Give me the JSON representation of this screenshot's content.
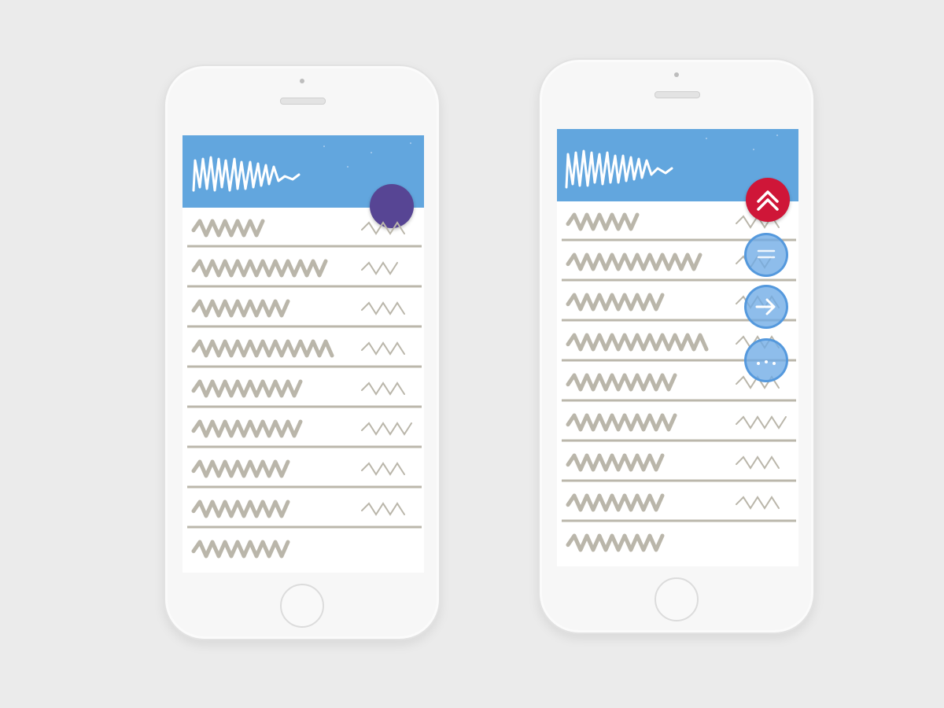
{
  "colors": {
    "background": "#ebebeb",
    "app_bar": "#62a6de",
    "primary_fab": "#574594",
    "speed_dial_top": "#cf1638",
    "speed_dial_actions": "#6eaae6",
    "scribble_text": "#bab6aa",
    "divider": "#bbb7ab"
  },
  "left_phone": {
    "app_bar": {
      "title_icon": "scribble-title"
    },
    "fab": {
      "icon": "none",
      "state": "collapsed"
    },
    "list_row_count": 9
  },
  "right_phone": {
    "app_bar": {
      "title_icon": "scribble-title"
    },
    "speed_dial": {
      "state": "expanded",
      "actions": [
        {
          "icon": "chevron-up-icon",
          "color": "#cf1638"
        },
        {
          "icon": "menu-lines-icon",
          "color": "#6eaae6"
        },
        {
          "icon": "arrow-right-icon",
          "color": "#6eaae6"
        },
        {
          "icon": "more-dots-icon",
          "color": "#6eaae6"
        }
      ]
    },
    "list_row_count": 9
  }
}
